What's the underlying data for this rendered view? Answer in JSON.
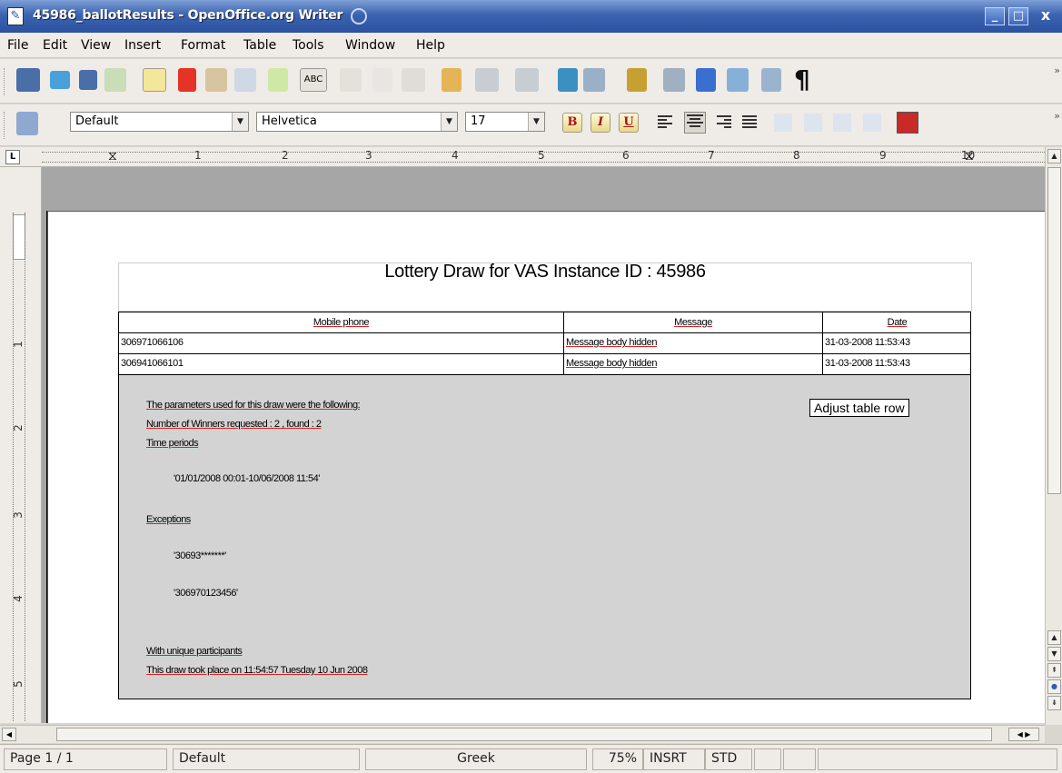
{
  "window": {
    "title": "45986_ballotResults - OpenOffice.org Writer",
    "minimize": "_",
    "maximize": "□",
    "close": "x"
  },
  "menu": [
    "File",
    "Edit",
    "View",
    "Insert",
    "Format",
    "Table",
    "Tools",
    "Window",
    "Help"
  ],
  "format_toolbar": {
    "style": "Default",
    "font": "Helvetica",
    "size": "17",
    "bold": "B",
    "italic": "I",
    "underline": "U"
  },
  "ruler": {
    "tab_marker": "L",
    "h_numbers": [
      "1",
      "2",
      "3",
      "4",
      "5",
      "6",
      "7",
      "8",
      "9",
      "10"
    ],
    "v_numbers": [
      "1",
      "2",
      "3",
      "4",
      "5"
    ]
  },
  "document": {
    "title": "Lottery Draw for VAS Instance ID  : 45986",
    "table": {
      "headers": [
        "Mobile phone",
        "Message",
        "Date"
      ],
      "rows": [
        [
          "306971066106",
          "Message body hidden",
          "31-03-2008 11:53:43"
        ],
        [
          "306941066101",
          "Message body hidden",
          "31-03-2008 11:53:43"
        ]
      ]
    },
    "params_intro": "The parameters used for this draw were the following:",
    "winners": "Number of Winners requested  : 2  ,  found  : 2",
    "time_label": "Time periods",
    "time_value": "'01/01/2008 00:01-10/06/2008 11:54'",
    "exceptions_label": "Exceptions",
    "exception_1": "'30693*******'",
    "exception_2": "'306970123456'",
    "unique": "With unique participants",
    "draw_time": "This draw took place on 11:54:57 Tuesday 10 Jun 2008",
    "tooltip": "Adjust table row"
  },
  "status": {
    "page": "Page 1 / 1",
    "style": "Default",
    "language": "Greek",
    "zoom": "75%",
    "insert_mode": "INSRT",
    "selection_mode": "STD"
  },
  "colors": {
    "titlebar": "#2c52a0",
    "toolbar_bg": "#efebe7",
    "doc_bg": "#a6a6a6",
    "table_gray": "#d3d3d3",
    "spell_underline": "#dd2222"
  }
}
